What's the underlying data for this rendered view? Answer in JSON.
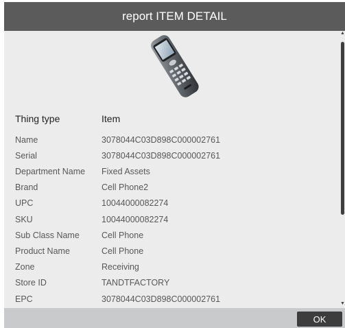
{
  "dialog": {
    "title": "report ITEM DETAIL"
  },
  "image": {
    "icon": "cell-phone-image"
  },
  "detail": {
    "header": {
      "label": "Thing type",
      "value": "Item"
    },
    "rows": [
      {
        "label": "Name",
        "value": "3078044C03D898C000002761"
      },
      {
        "label": "Serial",
        "value": "3078044C03D898C000002761"
      },
      {
        "label": "Department Name",
        "value": "Fixed Assets"
      },
      {
        "label": "Brand",
        "value": "Cell Phone2"
      },
      {
        "label": "UPC",
        "value": "10044000082274"
      },
      {
        "label": "SKU",
        "value": "10044000082274"
      },
      {
        "label": "Sub Class Name",
        "value": "Cell Phone"
      },
      {
        "label": "Product Name",
        "value": "Cell Phone"
      },
      {
        "label": "Zone",
        "value": "Receiving"
      },
      {
        "label": "Store ID",
        "value": "TANDTFACTORY"
      },
      {
        "label": "EPC",
        "value": "3078044C03D898C000002761"
      }
    ]
  },
  "footer": {
    "ok_label": "OK"
  },
  "colors": {
    "titlebar": "#5b5b5b",
    "content_bg": "#ececec",
    "footer_bg": "#c9cacc",
    "button_bg": "#3d3d3d"
  }
}
